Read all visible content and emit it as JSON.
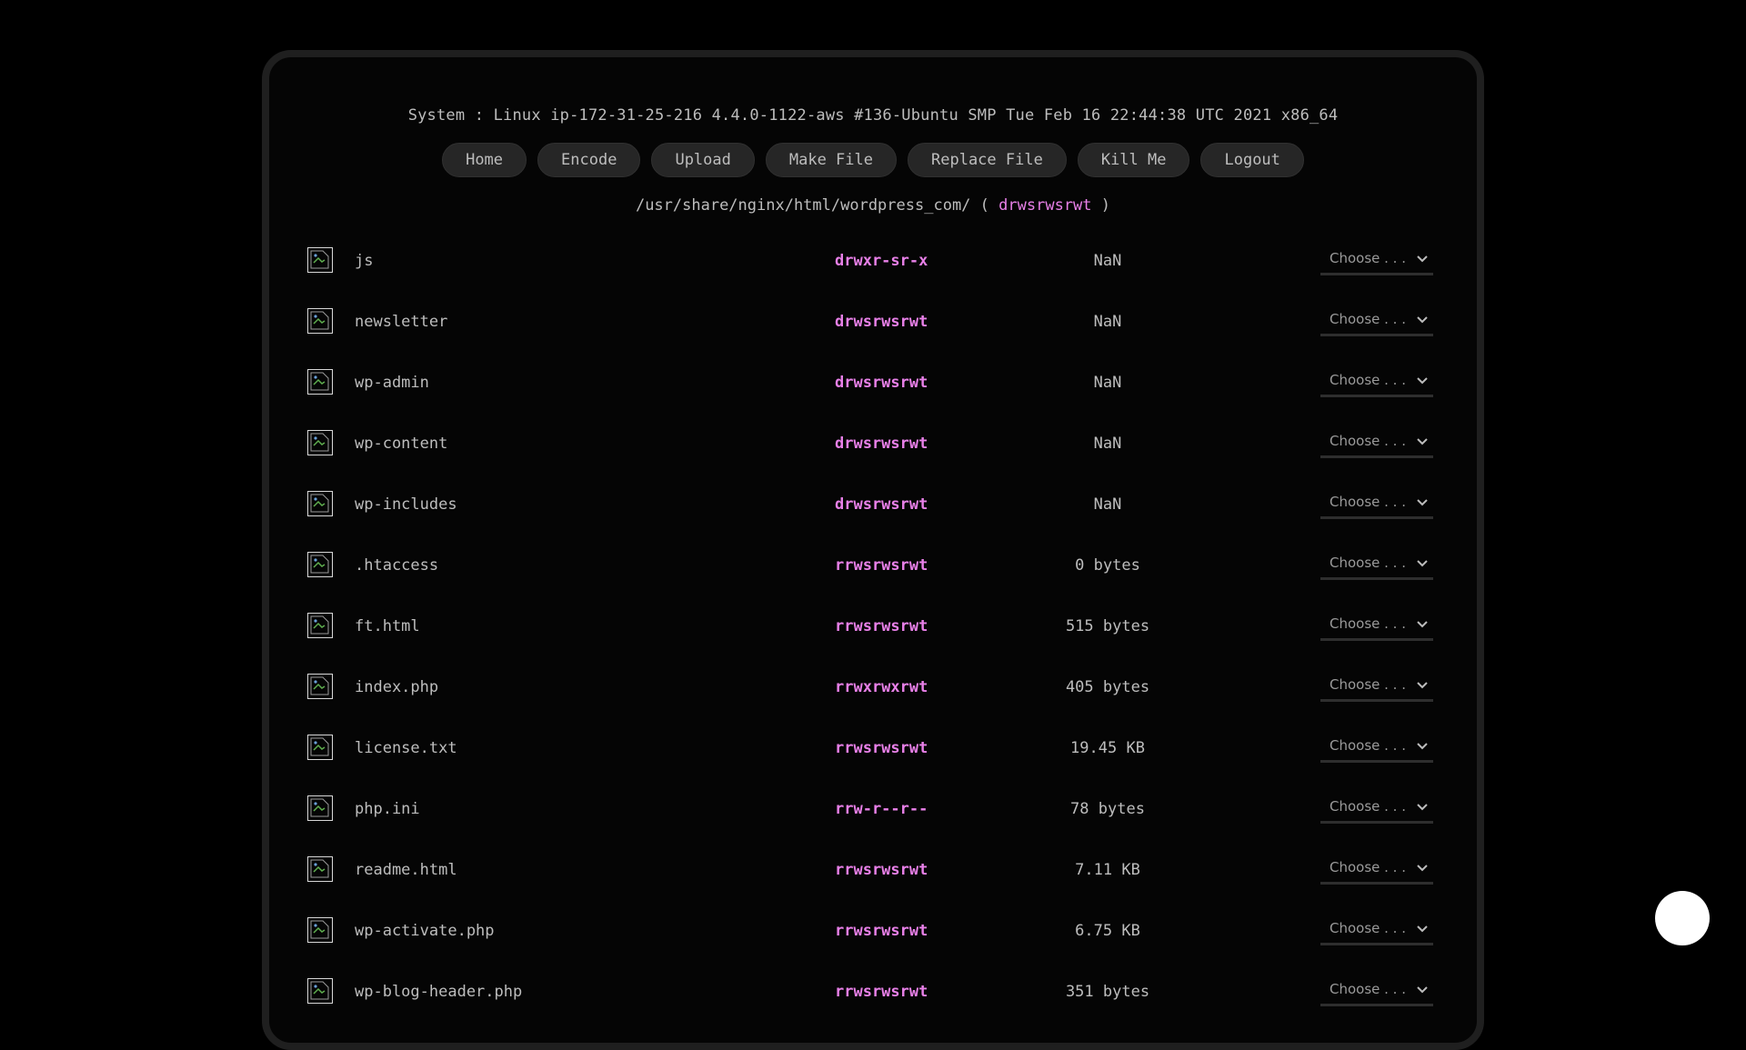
{
  "system_info": "System : Linux ip-172-31-25-216 4.4.0-1122-aws #136-Ubuntu SMP Tue Feb 16 22:44:38 UTC 2021 x86_64",
  "nav": {
    "home": "Home",
    "encode": "Encode",
    "upload": "Upload",
    "make_file": "Make File",
    "replace_file": "Replace File",
    "kill_me": "Kill Me",
    "logout": "Logout"
  },
  "path": {
    "dir": "/usr/share/nginx/html/wordpress_com/",
    "open": "(",
    "perms": "drwsrwsrwt",
    "close": ")"
  },
  "select_placeholder": "Choose . . .",
  "files": [
    {
      "name": "js",
      "perms": "drwxr-sr-x",
      "size": "NaN"
    },
    {
      "name": "newsletter",
      "perms": "drwsrwsrwt",
      "size": "NaN"
    },
    {
      "name": "wp-admin",
      "perms": "drwsrwsrwt",
      "size": "NaN"
    },
    {
      "name": "wp-content",
      "perms": "drwsrwsrwt",
      "size": "NaN"
    },
    {
      "name": "wp-includes",
      "perms": "drwsrwsrwt",
      "size": "NaN"
    },
    {
      "name": ".htaccess",
      "perms": "rrwsrwsrwt",
      "size": "0 bytes"
    },
    {
      "name": "ft.html",
      "perms": "rrwsrwsrwt",
      "size": "515 bytes"
    },
    {
      "name": "index.php",
      "perms": "rrwxrwxrwt",
      "size": "405 bytes"
    },
    {
      "name": "license.txt",
      "perms": "rrwsrwsrwt",
      "size": "19.45 KB"
    },
    {
      "name": "php.ini",
      "perms": "rrw-r--r--",
      "size": "78 bytes"
    },
    {
      "name": "readme.html",
      "perms": "rrwsrwsrwt",
      "size": "7.11 KB"
    },
    {
      "name": "wp-activate.php",
      "perms": "rrwsrwsrwt",
      "size": "6.75 KB"
    },
    {
      "name": "wp-blog-header.php",
      "perms": "rrwsrwsrwt",
      "size": "351 bytes"
    }
  ],
  "colors": {
    "background": "#000000",
    "panel_border": "#1f1f1f",
    "text": "#bdbdbd",
    "permission_accent": "#e880e8",
    "button_bg": "#262626",
    "fab": "#ffffff"
  },
  "icons": {
    "file_row": "broken-image-icon",
    "select": "chevron-down-icon",
    "floating": "circle-button"
  }
}
